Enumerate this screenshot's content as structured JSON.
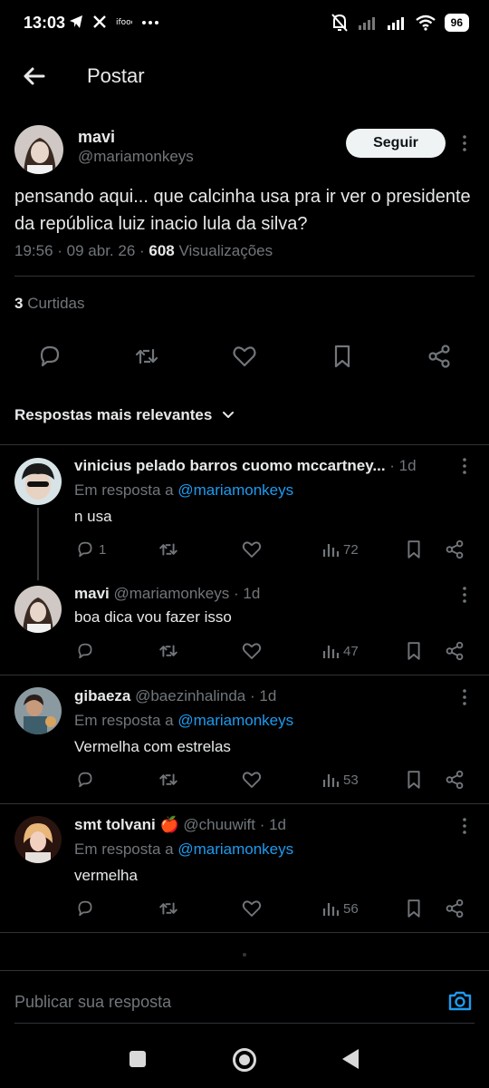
{
  "status_bar": {
    "time": "13:03",
    "battery": "96"
  },
  "header": {
    "title": "Postar"
  },
  "post": {
    "name": "mavi",
    "handle": "@mariamonkeys",
    "follow_label": "Seguir",
    "text": "pensando aqui... que calcinha usa pra ir ver o presidente da república luiz inacio lula da silva?",
    "time": "19:56 · 09 abr. 26 · ",
    "views_count": "608",
    "views_label": " Visualizações",
    "likes_count": "3",
    "likes_label": " Curtidas"
  },
  "sort": {
    "label": "Respostas mais relevantes"
  },
  "replies": [
    {
      "name": "vinicius pelado barros cuomo mccartney...",
      "handle": "",
      "age": " · 1d",
      "in_reply_prefix": "Em resposta a ",
      "in_reply_mention": "@mariamonkeys",
      "text": "n usa",
      "reply_count": "1",
      "views": "72"
    },
    {
      "name": "mavi",
      "handle": " @mariamonkeys",
      "age": " · 1d",
      "text": "boa dica vou fazer isso",
      "reply_count": "",
      "views": "47"
    },
    {
      "name": "gibaeza",
      "handle": " @baezinhalinda",
      "age": " · 1d",
      "in_reply_prefix": "Em resposta a ",
      "in_reply_mention": "@mariamonkeys",
      "text": "Vermelha com estrelas",
      "reply_count": "",
      "views": "53"
    },
    {
      "name": "smt tolvani 🍎",
      "handle": " @chuuwift",
      "age": " · 1d",
      "in_reply_prefix": "Em resposta a ",
      "in_reply_mention": "@mariamonkeys",
      "text": "vermelha",
      "reply_count": "",
      "views": "56"
    }
  ],
  "composer": {
    "placeholder": "Publicar sua resposta"
  },
  "colors": {
    "accent": "#1d9bf0",
    "muted": "#71767b",
    "text": "#e7e9ea",
    "border": "#2f3336"
  }
}
